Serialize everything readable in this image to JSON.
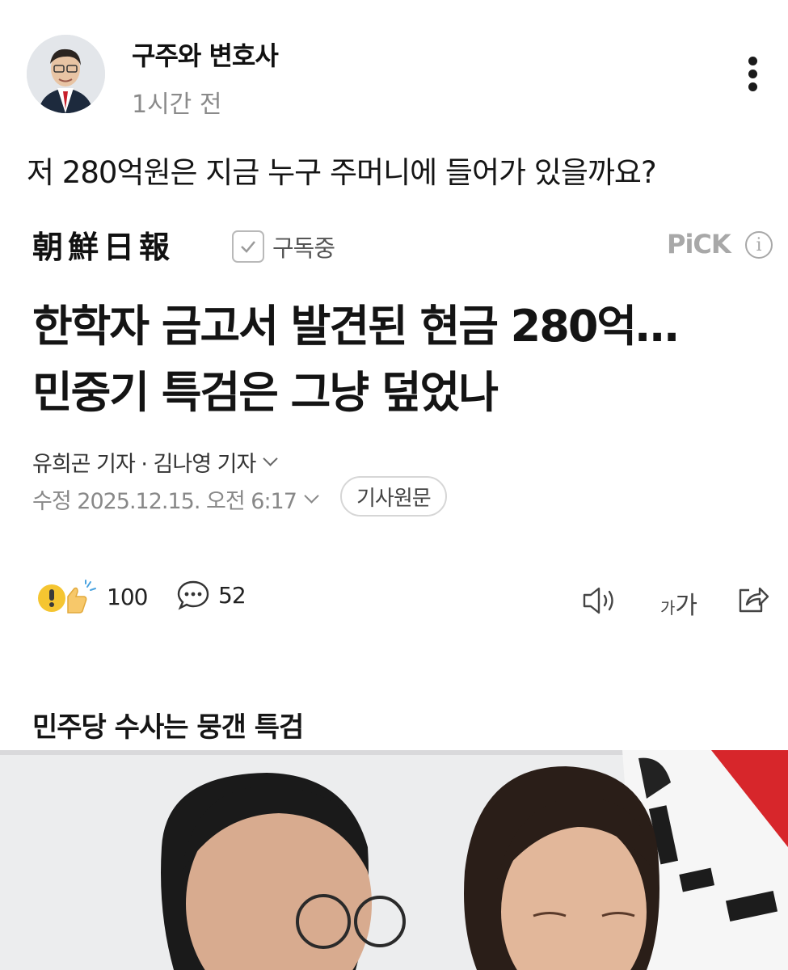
{
  "post": {
    "author": "구주와 변호사",
    "time": "1시간 전",
    "text": "저 280억원은 지금 누구 주머니에 들어가 있을까요?"
  },
  "article": {
    "press_name": "朝鮮日報",
    "subscribe_label": "구독중",
    "pick_label": "PiCK",
    "info_icon_text": "i",
    "headline_line1": "한학자 금고서 발견된 현금 280억…",
    "headline_line2": "민중기 특검은 그냥 덮었나",
    "reporters": "유희곤 기자 · 김나영 기자",
    "datetime": "수정 2025.12.15. 오전 6:17",
    "original_button": "기사원문",
    "reaction_count": "100",
    "comment_count": "52",
    "font_size_label": "가가",
    "section_title": "민주당 수사는 뭉갠 특검"
  },
  "colors": {
    "text": "#111111",
    "muted": "#888888",
    "pick": "#a8a8a8",
    "reaction_yellow": "#f5c531"
  },
  "icons": [
    "more-vertical-icon",
    "check-icon",
    "info-icon",
    "reaction-emoji-icon",
    "comment-icon",
    "speaker-icon",
    "font-size-icon",
    "share-icon",
    "chevron-down-icon"
  ]
}
